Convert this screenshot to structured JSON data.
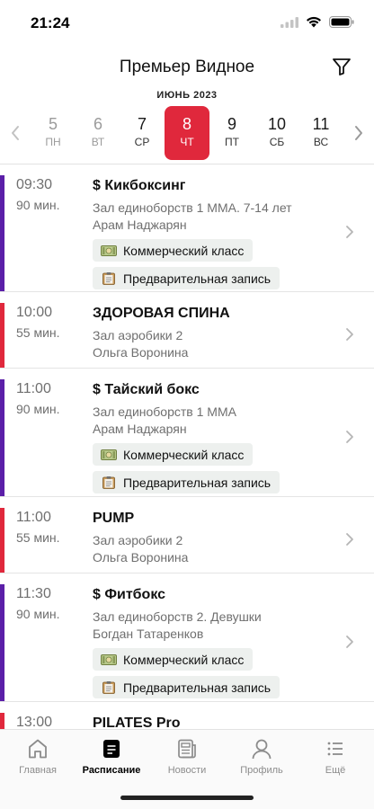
{
  "status_bar": {
    "time": "21:24",
    "icons": [
      "signal-icon",
      "wifi-icon",
      "battery-icon"
    ]
  },
  "header": {
    "title": "Премьер Видное",
    "filter_icon": "filter-icon"
  },
  "calendar": {
    "month": "ИЮНЬ 2023",
    "days": [
      {
        "num": "5",
        "dow": "ПН",
        "state": "past"
      },
      {
        "num": "6",
        "dow": "ВТ",
        "state": "past"
      },
      {
        "num": "7",
        "dow": "СР",
        "state": "future"
      },
      {
        "num": "8",
        "dow": "ЧТ",
        "state": "selected"
      },
      {
        "num": "9",
        "dow": "ПТ",
        "state": "future"
      },
      {
        "num": "10",
        "dow": "СБ",
        "state": "future"
      },
      {
        "num": "11",
        "dow": "ВС",
        "state": "future"
      }
    ],
    "selected_color": "#e0283c"
  },
  "colors": {
    "purple": "#5b1fa8",
    "red": "#e0283c"
  },
  "classes": [
    {
      "time": "09:30",
      "duration": "90 мин.",
      "title": "$ Кикбоксинг",
      "room": "Зал единоборств 1 MMA. 7-14 лет",
      "trainer": "Арам Наджарян",
      "tags": [
        "Коммерческий класс",
        "Предварительная запись"
      ],
      "color": "#5b1fa8"
    },
    {
      "time": "10:00",
      "duration": "55 мин.",
      "title": "ЗДОРОВАЯ СПИНА",
      "room": "Зал аэробики 2",
      "trainer": "Ольга Воронина",
      "tags": [],
      "color": "#e0283c"
    },
    {
      "time": "11:00",
      "duration": "90 мин.",
      "title": "$ Тайский бокс",
      "room": "Зал единоборств 1 MMA",
      "trainer": "Арам Наджарян",
      "tags": [
        "Коммерческий класс",
        "Предварительная запись"
      ],
      "color": "#5b1fa8"
    },
    {
      "time": "11:00",
      "duration": "55 мин.",
      "title": "PUMP",
      "room": "Зал аэробики 2",
      "trainer": "Ольга Воронина",
      "tags": [],
      "color": "#e0283c"
    },
    {
      "time": "11:30",
      "duration": "90 мин.",
      "title": "$ Фитбокс",
      "room": "Зал единоборств 2. Девушки",
      "trainer": "Богдан Татаренков",
      "tags": [
        "Коммерческий класс",
        "Предварительная запись"
      ],
      "color": "#5b1fa8"
    },
    {
      "time": "13:00",
      "duration": "",
      "title": "PILATES Pro",
      "room": "",
      "trainer": "",
      "tags": [],
      "color": "#e0283c"
    }
  ],
  "tabbar": {
    "items": [
      {
        "label": "Главная",
        "icon": "home-icon",
        "active": false
      },
      {
        "label": "Расписание",
        "icon": "schedule-icon",
        "active": true
      },
      {
        "label": "Новости",
        "icon": "news-icon",
        "active": false
      },
      {
        "label": "Профиль",
        "icon": "profile-icon",
        "active": false
      },
      {
        "label": "Ещё",
        "icon": "more-icon",
        "active": false
      }
    ]
  }
}
